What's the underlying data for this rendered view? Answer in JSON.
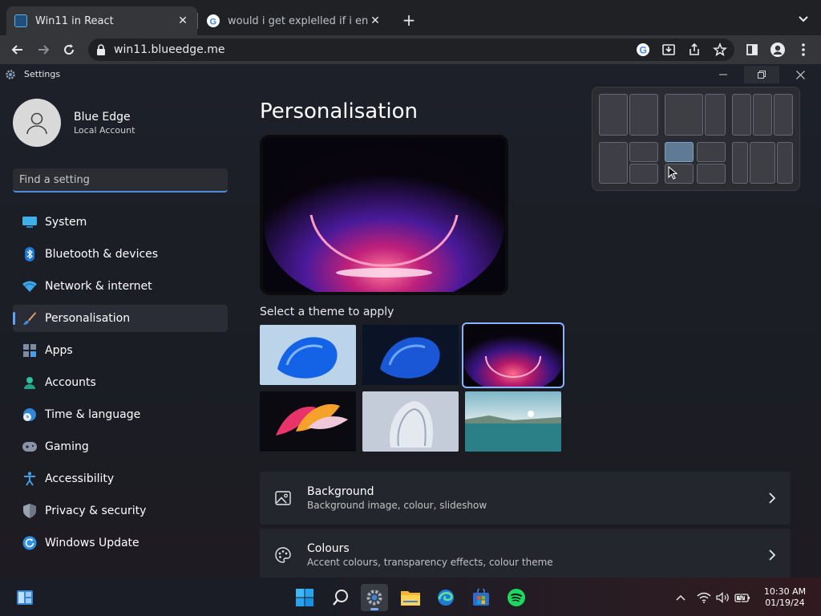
{
  "browser": {
    "tabs": [
      {
        "title": "Win11 in React",
        "active": true
      },
      {
        "title": "would i get explelled if i enable",
        "active": false
      }
    ],
    "url": "win11.blueedge.me"
  },
  "window": {
    "app_title": "Settings"
  },
  "account": {
    "name": "Blue Edge",
    "type": "Local Account"
  },
  "search": {
    "placeholder": "Find a setting"
  },
  "nav": [
    {
      "label": "System",
      "icon": "monitor-icon"
    },
    {
      "label": "Bluetooth & devices",
      "icon": "bluetooth-icon"
    },
    {
      "label": "Network & internet",
      "icon": "wifi-icon"
    },
    {
      "label": "Personalisation",
      "icon": "brush-icon",
      "selected": true
    },
    {
      "label": "Apps",
      "icon": "apps-icon"
    },
    {
      "label": "Accounts",
      "icon": "person-icon"
    },
    {
      "label": "Time & language",
      "icon": "globe-clock-icon"
    },
    {
      "label": "Gaming",
      "icon": "gamepad-icon"
    },
    {
      "label": "Accessibility",
      "icon": "accessibility-icon"
    },
    {
      "label": "Privacy & security",
      "icon": "shield-icon"
    },
    {
      "label": "Windows Update",
      "icon": "update-icon"
    }
  ],
  "main": {
    "title": "Personalisation",
    "theme_label": "Select a theme to apply",
    "cards": [
      {
        "title": "Background",
        "subtitle": "Background image, colour, slideshow",
        "icon": "image-icon"
      },
      {
        "title": "Colours",
        "subtitle": "Accent colours, transparency effects, colour theme",
        "icon": "palette-icon"
      }
    ]
  },
  "taskbar": {
    "time": "10:30 AM",
    "date": "01/19/24"
  },
  "colors": {
    "accent": "#5da3ff",
    "window_bg": "#1d2029",
    "card_bg": "#24262d"
  }
}
